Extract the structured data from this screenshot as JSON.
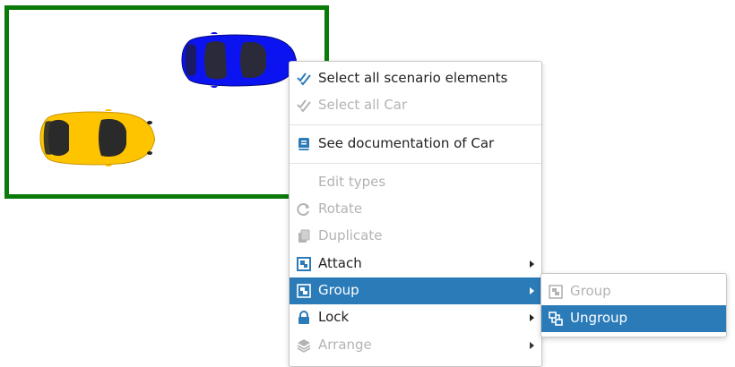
{
  "menu": {
    "items": [
      {
        "label": "Select all scenario elements",
        "icon": "double-check-icon",
        "disabled": false
      },
      {
        "label": "Select all Car",
        "icon": "double-check-icon",
        "disabled": true
      },
      {
        "label": "See documentation of Car",
        "icon": "book-icon",
        "disabled": false
      },
      {
        "label": "Edit types",
        "icon": "",
        "disabled": true
      },
      {
        "label": "Rotate",
        "icon": "rotate-icon",
        "disabled": true
      },
      {
        "label": "Duplicate",
        "icon": "copy-icon",
        "disabled": true
      },
      {
        "label": "Attach",
        "icon": "attach-icon",
        "disabled": false,
        "submenu": true
      },
      {
        "label": "Group",
        "icon": "group-icon",
        "disabled": false,
        "submenu": true,
        "active": true
      },
      {
        "label": "Lock",
        "icon": "lock-icon",
        "disabled": false,
        "submenu": true
      },
      {
        "label": "Arrange",
        "icon": "layers-icon",
        "disabled": true,
        "submenu": true
      }
    ]
  },
  "submenu": {
    "items": [
      {
        "label": "Group",
        "icon": "group-icon",
        "disabled": true
      },
      {
        "label": "Ungroup",
        "icon": "ungroup-icon",
        "disabled": false,
        "active": true
      }
    ]
  },
  "colors": {
    "frame_border": "#0a7a0a",
    "active_bg": "#2b7bb9",
    "icon_blue": "#2b7bb9",
    "disabled_text": "#b3b3b3",
    "car_blue": "#0b14f0",
    "car_yellow": "#ffc400"
  }
}
